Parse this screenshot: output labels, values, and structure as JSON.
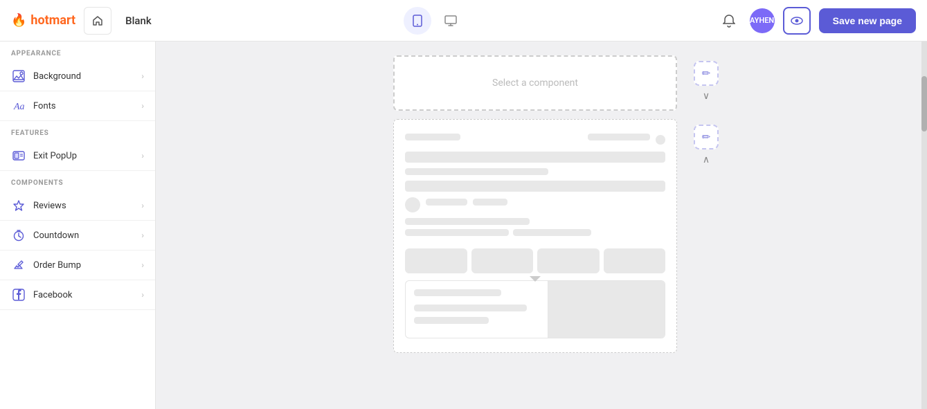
{
  "logo": {
    "flame": "🔥",
    "name": "hotmart"
  },
  "tabs": {
    "home_icon": "⌂",
    "page_title": "Blank"
  },
  "device_toggle": {
    "mobile_icon": "📱",
    "desktop_icon": "🖥"
  },
  "topbar": {
    "bell_icon": "🔔",
    "preview_icon": "👁",
    "save_label": "Save new page",
    "avatar_text": "AYHEN"
  },
  "sidebar": {
    "appearance_label": "APPEARANCE",
    "appearance_items": [
      {
        "id": "background",
        "label": "Background",
        "icon": "background"
      },
      {
        "id": "fonts",
        "label": "Fonts",
        "icon": "fonts"
      }
    ],
    "features_label": "FEATURES",
    "features_items": [
      {
        "id": "exit-popup",
        "label": "Exit PopUp",
        "icon": "popup"
      }
    ],
    "components_label": "COMPONENTS",
    "components_items": [
      {
        "id": "reviews",
        "label": "Reviews",
        "icon": "reviews"
      },
      {
        "id": "countdown",
        "label": "Countdown",
        "icon": "countdown"
      },
      {
        "id": "order-bump",
        "label": "Order Bump",
        "icon": "orderbump"
      },
      {
        "id": "facebook",
        "label": "Facebook",
        "icon": "facebook"
      }
    ]
  },
  "canvas": {
    "select_placeholder": "Select a component",
    "edit_icon": "✏",
    "collapse_icon": "∨",
    "expand_icon": "∧"
  }
}
